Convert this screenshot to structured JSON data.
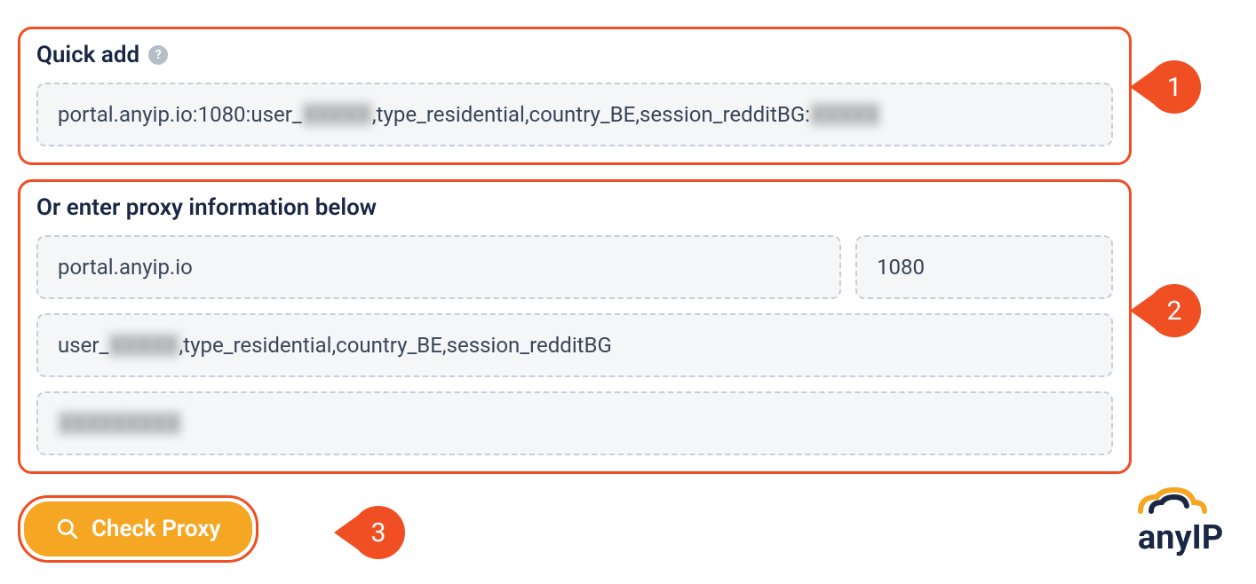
{
  "quickAdd": {
    "title": "Quick add",
    "valuePrefix": "portal.anyip.io:1080:user_",
    "valueBlur1": "XXXXX",
    "valueMiddle": ",type_residential,country_BE,session_redditBG:",
    "valueBlur2": "XXXXX"
  },
  "manual": {
    "title": "Or enter proxy information below",
    "host": "portal.anyip.io",
    "port": "1080",
    "usernamePrefix": "user_",
    "usernameBlur": "XXXXX",
    "usernameSuffix": ",type_residential,country_BE,session_redditBG",
    "passwordBlur": "XXXXXXXXX"
  },
  "button": {
    "label": "Check Proxy"
  },
  "callouts": {
    "one": "1",
    "two": "2",
    "three": "3"
  },
  "logo": {
    "text": "anyIP"
  },
  "colors": {
    "accent": "#f04e23",
    "button": "#f5a623",
    "heading": "#1a2744"
  }
}
